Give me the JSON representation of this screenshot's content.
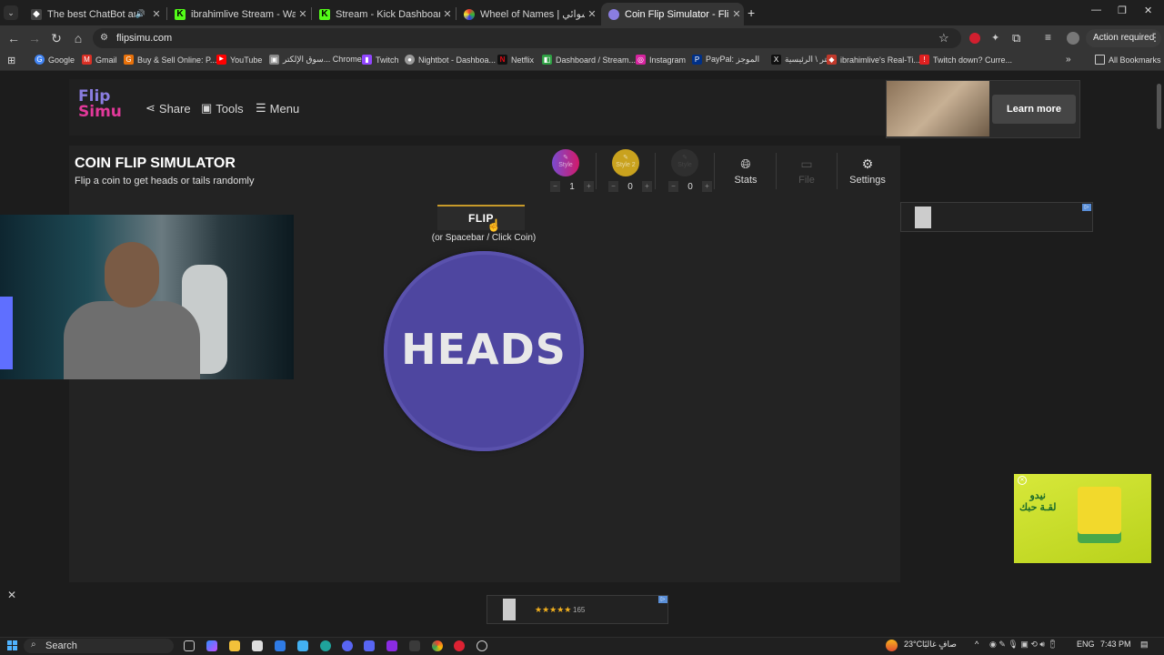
{
  "browser": {
    "tabs": [
      {
        "title": "The best ChatBot and Widg",
        "icon": "chatbot-icon",
        "audio": true
      },
      {
        "title": "ibrahimlive Stream - Watch Live",
        "icon": "kick-icon"
      },
      {
        "title": "Stream - Kick Dashboard",
        "icon": "kick-icon"
      },
      {
        "title": "Wheel of Names | اسم العشوائي",
        "icon": "wheel-icon"
      },
      {
        "title": "Coin Flip Simulator - Flip a Coin",
        "icon": "flipsimu-icon",
        "active": true
      }
    ],
    "url": "flipsimu.com",
    "action_required": "Action required",
    "bookmarks": [
      {
        "label": "Google",
        "color": "#4285f4",
        "glyph": "G"
      },
      {
        "label": "Gmail",
        "color": "#d93025",
        "glyph": "M"
      },
      {
        "label": "Buy & Sell Online: P...",
        "color": "#e8710a",
        "glyph": "G"
      },
      {
        "label": "YouTube",
        "color": "#ff0000",
        "glyph": "▶"
      },
      {
        "label": "سوق الإلكتر... Chrome",
        "color": "#888888",
        "glyph": "▣"
      },
      {
        "label": "Twitch",
        "color": "#9146ff",
        "glyph": "▮"
      },
      {
        "label": "Nightbot - Dashboa...",
        "color": "#999999",
        "glyph": "●"
      },
      {
        "label": "Netflix",
        "color": "#e50914",
        "glyph": "N"
      },
      {
        "label": "Dashboard / Stream...",
        "color": "#2ea043",
        "glyph": "◧"
      },
      {
        "label": "Instagram",
        "color": "#d6249f",
        "glyph": "◎"
      },
      {
        "label": "PayPal: الموجز",
        "color": "#003087",
        "glyph": "P"
      },
      {
        "label": "تويتر \\ الرئيسية",
        "color": "#111111",
        "glyph": "X"
      },
      {
        "label": "ibrahimlive's Real-Ti...",
        "color": "#c0392b",
        "glyph": "◆"
      },
      {
        "label": "Twitch down? Curre...",
        "color": "#e02020",
        "glyph": "!"
      }
    ],
    "all_bookmarks": "All Bookmarks"
  },
  "site": {
    "logo_line1": "Flip",
    "logo_line2": "Simu",
    "nav": {
      "share": "Share",
      "tools": "Tools",
      "menu": "Menu"
    },
    "title": "COIN FLIP SIMULATOR",
    "subtitle": "Flip a coin to get heads or tails randomly",
    "styles": [
      {
        "label": "Style",
        "count": "1",
        "color": "#b02a8a"
      },
      {
        "label": "Style 2",
        "count": "0",
        "color": "#c9a21e"
      },
      {
        "label": "Style",
        "count": "0",
        "color": "#3a3a3a"
      }
    ],
    "stats_label": "Stats",
    "file_label": "File",
    "settings_label": "Settings",
    "flip_button": "FLIP",
    "flip_hint": "(or Spacebar / Click Coin)",
    "coin_result": "HEADS",
    "coin_color": "#4e46a0"
  },
  "ads": {
    "top_learn_more": "Learn more",
    "video_text": "نيدو\nلقـة حبك",
    "bottom_stars": "★★★★★",
    "bottom_count": "165",
    "close": "✕"
  },
  "taskbar": {
    "search": "Search",
    "weather": "23°C",
    "weather_desc": "صافٍ غالبًا",
    "lang": "ENG",
    "time": "7:43 PM"
  }
}
